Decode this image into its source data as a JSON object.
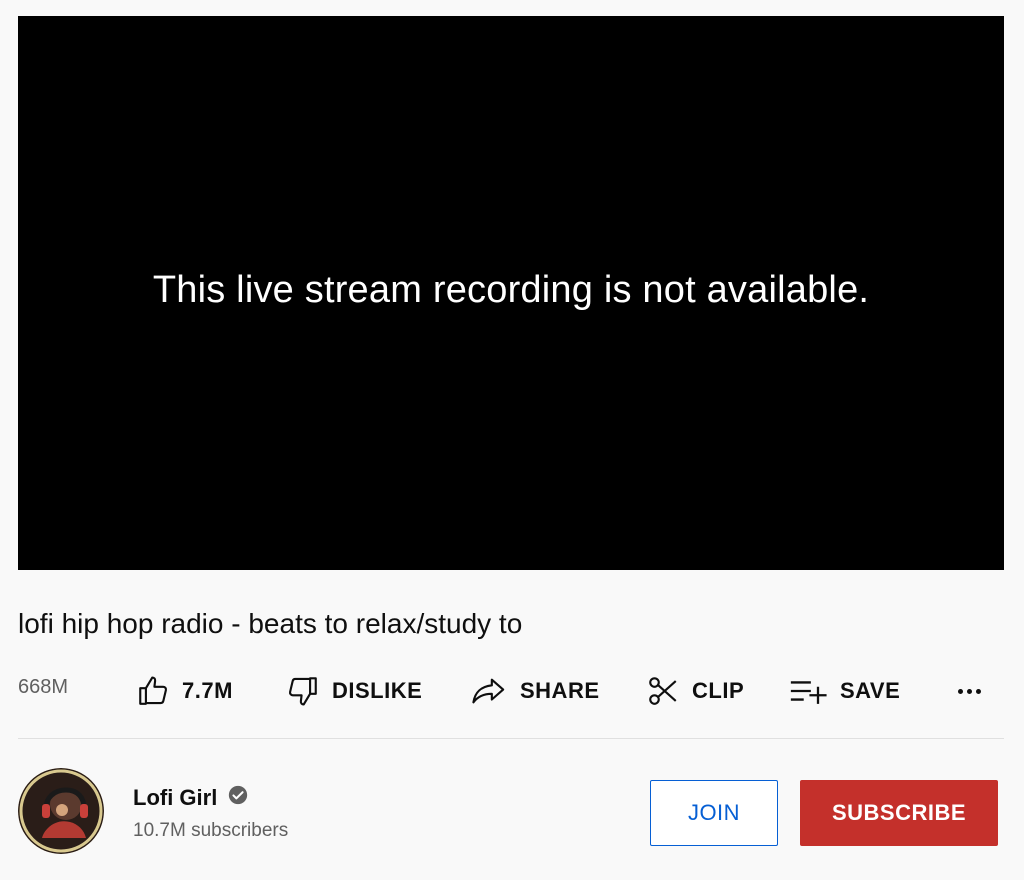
{
  "player": {
    "message": "This live stream recording is not available."
  },
  "video": {
    "title": "lofi hip hop radio - beats to relax/study to",
    "views": "668M"
  },
  "actions": {
    "like_count": "7.7M",
    "dislike_label": "DISLIKE",
    "share_label": "SHARE",
    "clip_label": "CLIP",
    "save_label": "SAVE"
  },
  "channel": {
    "name": "Lofi Girl",
    "subscribers": "10.7M subscribers",
    "verified": true
  },
  "buttons": {
    "join_label": "JOIN",
    "subscribe_label": "SUBSCRIBE"
  },
  "colors": {
    "subscribe_bg": "#c4302b",
    "join_accent": "#065fd4",
    "player_bg": "#000000"
  },
  "icons": [
    "thumbs-up-icon",
    "thumbs-down-icon",
    "share-arrow-icon",
    "scissors-icon",
    "playlist-add-icon",
    "more-dots-icon",
    "verified-check-icon"
  ]
}
